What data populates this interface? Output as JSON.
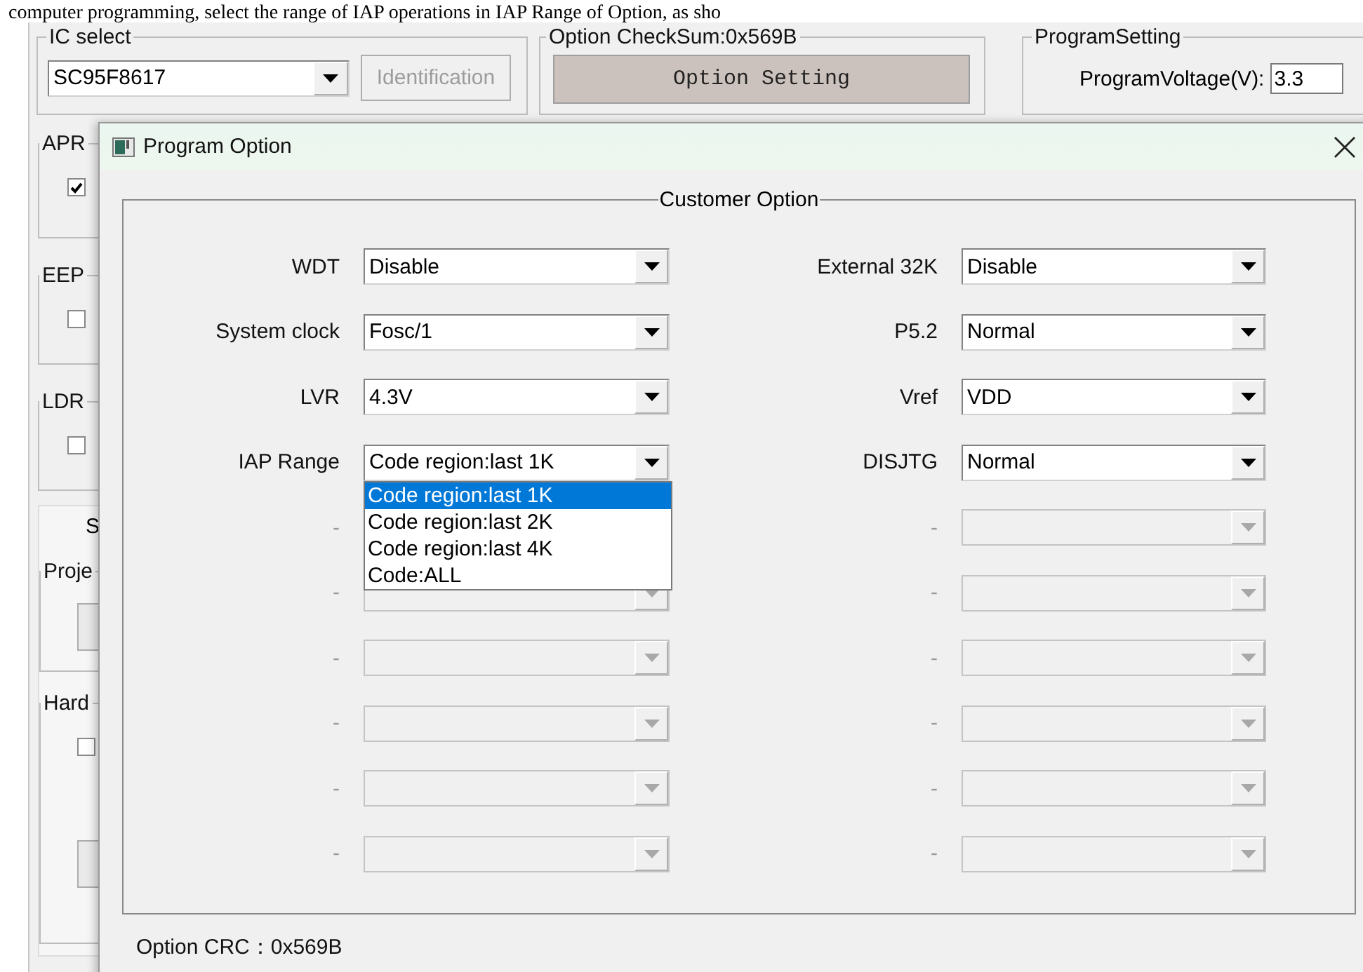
{
  "caption": "computer programming, select the range of IAP operations in IAP Range of Option, as sho",
  "main": {
    "ic_select": {
      "title": "IC select",
      "value": "SC95F8617",
      "identify_button": {
        "label": "Identification",
        "disabled": true
      }
    },
    "option": {
      "title": "Option  CheckSum:0x569B",
      "button": "Option Setting"
    },
    "program_setting": {
      "title": "ProgramSetting",
      "voltage_label": "ProgramVoltage(V):",
      "voltage_value": "3.3"
    },
    "side_groups": [
      {
        "title": "APR",
        "checked": true
      },
      {
        "title": "EEP",
        "checked": false
      },
      {
        "title": "LDR",
        "checked": false
      }
    ],
    "tab_label": "S",
    "project_group": {
      "title": "Proje"
    },
    "hardware_group": {
      "title": "Hard",
      "checked": false
    }
  },
  "dialog": {
    "title": "Program Option",
    "group_title": "Customer Option",
    "left_options": [
      {
        "label": "WDT",
        "value": "Disable",
        "disabled": false
      },
      {
        "label": "System clock",
        "value": "Fosc/1",
        "disabled": false
      },
      {
        "label": "LVR",
        "value": "4.3V",
        "disabled": false
      },
      {
        "label": "IAP Range",
        "value": "Code region:last 1K",
        "disabled": false,
        "expanded": true,
        "items": [
          {
            "label": "Code region:last 1K",
            "selected": true
          },
          {
            "label": "Code region:last 2K",
            "selected": false
          },
          {
            "label": "Code region:last 4K",
            "selected": false
          },
          {
            "label": "Code:ALL",
            "selected": false
          }
        ]
      },
      {
        "label": "-",
        "disabled": true
      },
      {
        "label": "-",
        "disabled": true
      },
      {
        "label": "-",
        "disabled": true
      },
      {
        "label": "-",
        "disabled": true
      },
      {
        "label": "-",
        "disabled": true
      },
      {
        "label": "-",
        "disabled": true
      }
    ],
    "right_options": [
      {
        "label": "External 32K",
        "value": "Disable",
        "disabled": false
      },
      {
        "label": "P5.2",
        "value": "Normal",
        "disabled": false
      },
      {
        "label": "Vref",
        "value": "VDD",
        "disabled": false
      },
      {
        "label": "DISJTG",
        "value": "Normal",
        "disabled": false
      },
      {
        "label": "-",
        "disabled": true
      },
      {
        "label": "-",
        "disabled": true
      },
      {
        "label": "-",
        "disabled": true
      },
      {
        "label": "-",
        "disabled": true
      },
      {
        "label": "-",
        "disabled": true
      },
      {
        "label": "-",
        "disabled": true
      }
    ],
    "crc": "Option CRC：0x569B"
  }
}
